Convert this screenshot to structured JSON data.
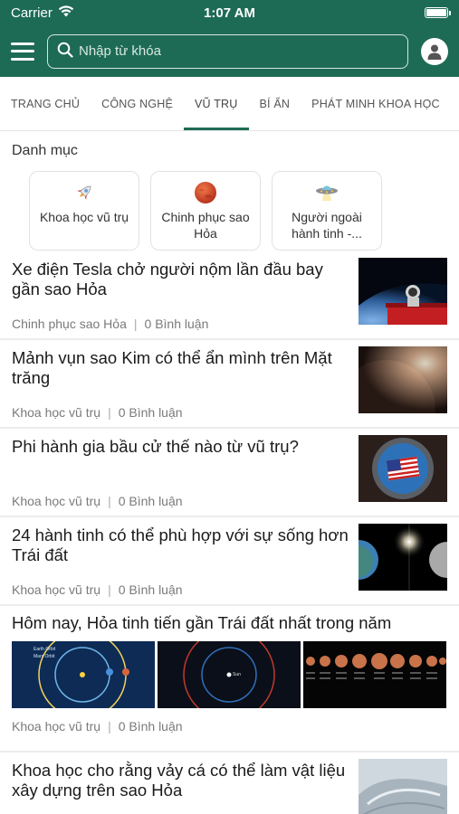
{
  "status": {
    "carrier": "Carrier",
    "time": "1:07 AM"
  },
  "search": {
    "placeholder": "Nhập từ khóa"
  },
  "tabs": [
    {
      "label": "TRANG CHỦ"
    },
    {
      "label": "CÔNG NGHỆ"
    },
    {
      "label": "VŨ TRỤ",
      "active": true
    },
    {
      "label": "BÍ ẨN"
    },
    {
      "label": "PHÁT MINH KHOA HỌC"
    }
  ],
  "categories_title": "Danh mục",
  "categories": [
    {
      "label": "Khoa học vũ trụ",
      "icon": "rocket-icon"
    },
    {
      "label": "Chinh phục sao Hỏa",
      "icon": "mars-icon"
    },
    {
      "label": "Người ngoài hành tinh -...",
      "icon": "ufo-icon"
    }
  ],
  "articles": [
    {
      "title": "Xe điện Tesla chở người nộm lần đầu bay gần sao Hỏa",
      "category": "Chinh phục sao Hỏa",
      "comments": "0 Bình luận"
    },
    {
      "title": "Mảnh vụn sao Kim có thể ẩn mình trên Mặt trăng",
      "category": "Khoa học vũ trụ",
      "comments": "0 Bình luận"
    },
    {
      "title": "Phi hành gia bầu cử thế nào từ vũ trụ?",
      "category": "Khoa học vũ trụ",
      "comments": "0 Bình luận"
    },
    {
      "title": "24 hành tinh có thể phù hợp với sự sống hơn Trái đất",
      "category": "Khoa học vũ trụ",
      "comments": "0 Bình luận"
    },
    {
      "title": "Hôm nay, Hỏa tinh tiến gần Trái đất nhất trong năm",
      "category": "Khoa học vũ trụ",
      "comments": "0 Bình luận"
    },
    {
      "title": "Khoa học cho rằng vảy cá có thể làm vật liệu xây dựng trên sao Hỏa",
      "category": "",
      "comments": ""
    }
  ],
  "image_labels": {
    "orbit_earth": "Earth Orbit",
    "orbit_mars": "Mars Orbit",
    "sun": "Sun"
  }
}
